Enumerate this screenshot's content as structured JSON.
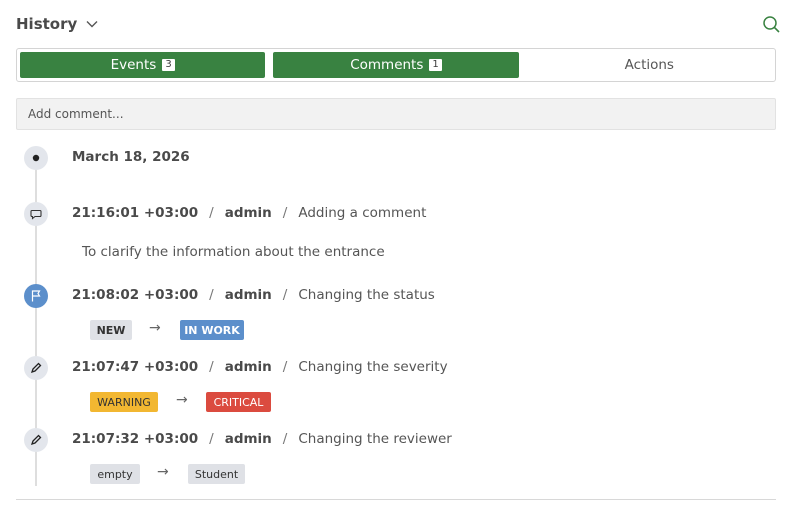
{
  "header": {
    "title": "History"
  },
  "tabs": [
    {
      "label": "Events",
      "count": "3"
    },
    {
      "label": "Comments",
      "count": "1"
    },
    {
      "label": "Actions"
    }
  ],
  "comment_input": {
    "placeholder": "Add comment..."
  },
  "timeline": {
    "date": "March 18, 2026",
    "events": [
      {
        "time": "21:16:01 +03:00",
        "user": "admin",
        "action": "Adding a comment",
        "comment": "To clarify the information about the entrance"
      },
      {
        "time": "21:08:02 +03:00",
        "user": "admin",
        "action": "Changing the status",
        "from": "NEW",
        "to": "IN WORK"
      },
      {
        "time": "21:07:47 +03:00",
        "user": "admin",
        "action": "Changing the severity",
        "from": "WARNING",
        "to": "CRITICAL"
      },
      {
        "time": "21:07:32 +03:00",
        "user": "admin",
        "action": "Changing the reviewer",
        "from": "empty",
        "to": "Student"
      }
    ]
  },
  "separator": "/",
  "arrow": "→",
  "colors": {
    "accent": "#398241",
    "status_blue": "#5c8fcb",
    "warning": "#f2b731",
    "critical": "#db4b3f",
    "neutral_badge": "#dfe1e6"
  }
}
